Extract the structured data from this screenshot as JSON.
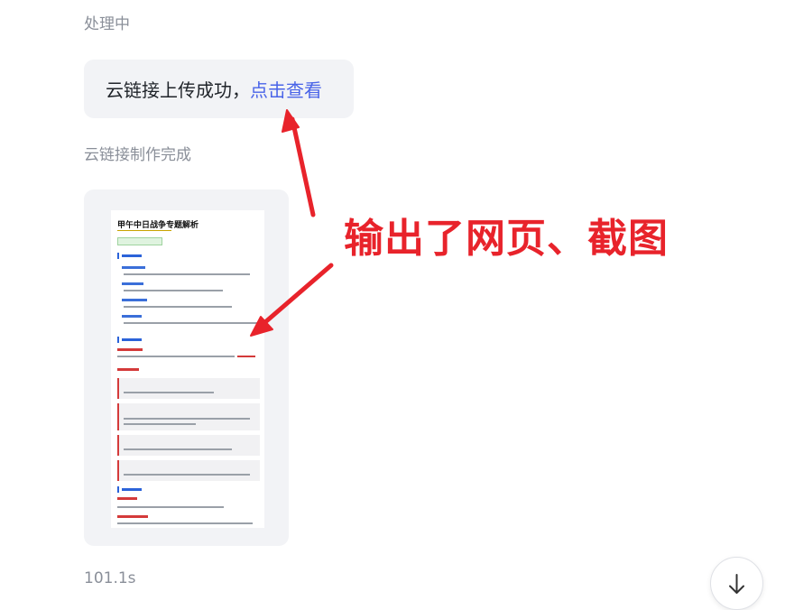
{
  "messages": {
    "status_processing": "处理中",
    "upload_text": "云链接上传成功，",
    "upload_link": "点击查看",
    "status_done": "云链接制作完成",
    "elapsed": "101.1s"
  },
  "screenshot_preview": {
    "title": "甲午中日战争专题解析"
  },
  "annotation": {
    "text": "输出了网页、截图",
    "color": "#e8232b"
  },
  "colors": {
    "link": "#4a64e8",
    "bubble_bg": "#f2f3f6",
    "muted_text": "#8a8f99"
  },
  "icons": {
    "scroll_down": "arrow-down-icon"
  }
}
